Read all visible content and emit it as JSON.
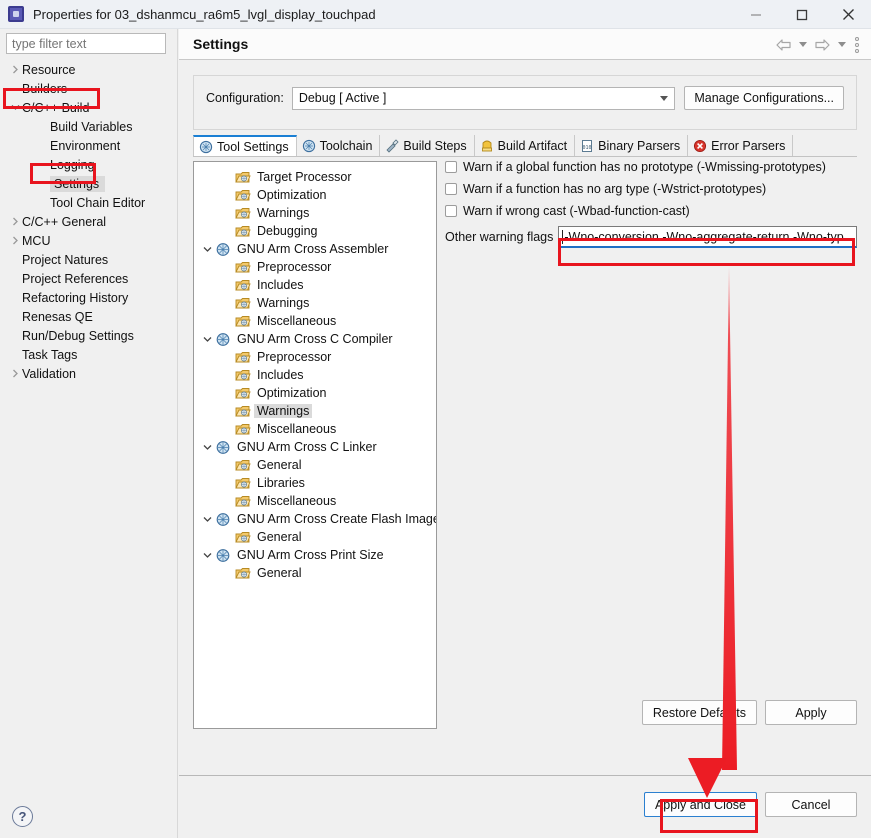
{
  "window": {
    "title": "Properties for 03_dshanmcu_ra6m5_lvgl_display_touchpad",
    "icon": "properties-app-icon",
    "minimize_label": "minimize-icon",
    "maximize_label": "maximize-icon",
    "close_label": "close-icon"
  },
  "sidebar": {
    "filter_placeholder": "type filter text",
    "filter_value": "",
    "items": [
      {
        "label": "Resource",
        "indent": 0,
        "twisty": "collapsed",
        "selected": false
      },
      {
        "label": "Builders",
        "indent": 0,
        "twisty": "none",
        "selected": false
      },
      {
        "label": "C/C++ Build",
        "indent": 0,
        "twisty": "expanded",
        "selected": false
      },
      {
        "label": "Build Variables",
        "indent": 1,
        "twisty": "none",
        "selected": false
      },
      {
        "label": "Environment",
        "indent": 1,
        "twisty": "none",
        "selected": false
      },
      {
        "label": "Logging",
        "indent": 1,
        "twisty": "none",
        "selected": false
      },
      {
        "label": "Settings",
        "indent": 1,
        "twisty": "none",
        "selected": true
      },
      {
        "label": "Tool Chain Editor",
        "indent": 1,
        "twisty": "none",
        "selected": false
      },
      {
        "label": "C/C++ General",
        "indent": 0,
        "twisty": "collapsed",
        "selected": false
      },
      {
        "label": "MCU",
        "indent": 0,
        "twisty": "collapsed",
        "selected": false
      },
      {
        "label": "Project Natures",
        "indent": 0,
        "twisty": "none",
        "selected": false
      },
      {
        "label": "Project References",
        "indent": 0,
        "twisty": "none",
        "selected": false
      },
      {
        "label": "Refactoring History",
        "indent": 0,
        "twisty": "none",
        "selected": false
      },
      {
        "label": "Renesas QE",
        "indent": 0,
        "twisty": "none",
        "selected": false
      },
      {
        "label": "Run/Debug Settings",
        "indent": 0,
        "twisty": "none",
        "selected": false
      },
      {
        "label": "Task Tags",
        "indent": 0,
        "twisty": "none",
        "selected": false
      },
      {
        "label": "Validation",
        "indent": 0,
        "twisty": "collapsed",
        "selected": false
      }
    ],
    "help_icon": "?"
  },
  "header": {
    "title": "Settings",
    "back_icon": "back-arrow-icon",
    "forward_icon": "forward-arrow-icon",
    "menu_icon": "view-menu-icon"
  },
  "configuration": {
    "label": "Configuration:",
    "value": "Debug  [ Active ]",
    "manage_button": "Manage Configurations..."
  },
  "tabs": [
    {
      "label": "Tool Settings",
      "icon": "tool-settings-icon",
      "active": true
    },
    {
      "label": "Toolchain",
      "icon": "toolchain-icon",
      "active": false
    },
    {
      "label": "Build Steps",
      "icon": "build-steps-icon",
      "active": false
    },
    {
      "label": "Build Artifact",
      "icon": "build-artifact-icon",
      "active": false
    },
    {
      "label": "Binary Parsers",
      "icon": "binary-parsers-icon",
      "active": false
    },
    {
      "label": "Error Parsers",
      "icon": "error-parsers-icon",
      "active": false
    }
  ],
  "tool_tree": [
    {
      "label": "Target Processor",
      "indent": 1,
      "twisty": "none",
      "icon": "page-icon",
      "selected": false
    },
    {
      "label": "Optimization",
      "indent": 1,
      "twisty": "none",
      "icon": "page-icon",
      "selected": false
    },
    {
      "label": "Warnings",
      "indent": 1,
      "twisty": "none",
      "icon": "page-icon",
      "selected": false
    },
    {
      "label": "Debugging",
      "indent": 1,
      "twisty": "none",
      "icon": "page-icon",
      "selected": false
    },
    {
      "label": "GNU Arm Cross Assembler",
      "indent": 0,
      "twisty": "expanded",
      "icon": "tool-icon",
      "selected": false
    },
    {
      "label": "Preprocessor",
      "indent": 1,
      "twisty": "none",
      "icon": "page-icon",
      "selected": false
    },
    {
      "label": "Includes",
      "indent": 1,
      "twisty": "none",
      "icon": "page-icon",
      "selected": false
    },
    {
      "label": "Warnings",
      "indent": 1,
      "twisty": "none",
      "icon": "page-icon",
      "selected": false
    },
    {
      "label": "Miscellaneous",
      "indent": 1,
      "twisty": "none",
      "icon": "page-icon",
      "selected": false
    },
    {
      "label": "GNU Arm Cross C Compiler",
      "indent": 0,
      "twisty": "expanded",
      "icon": "tool-icon",
      "selected": false
    },
    {
      "label": "Preprocessor",
      "indent": 1,
      "twisty": "none",
      "icon": "page-icon",
      "selected": false
    },
    {
      "label": "Includes",
      "indent": 1,
      "twisty": "none",
      "icon": "page-icon",
      "selected": false
    },
    {
      "label": "Optimization",
      "indent": 1,
      "twisty": "none",
      "icon": "page-icon",
      "selected": false
    },
    {
      "label": "Warnings",
      "indent": 1,
      "twisty": "none",
      "icon": "page-icon",
      "selected": true
    },
    {
      "label": "Miscellaneous",
      "indent": 1,
      "twisty": "none",
      "icon": "page-icon",
      "selected": false
    },
    {
      "label": "GNU Arm Cross C Linker",
      "indent": 0,
      "twisty": "expanded",
      "icon": "tool-icon",
      "selected": false
    },
    {
      "label": "General",
      "indent": 1,
      "twisty": "none",
      "icon": "page-icon",
      "selected": false
    },
    {
      "label": "Libraries",
      "indent": 1,
      "twisty": "none",
      "icon": "page-icon",
      "selected": false
    },
    {
      "label": "Miscellaneous",
      "indent": 1,
      "twisty": "none",
      "icon": "page-icon",
      "selected": false
    },
    {
      "label": "GNU Arm Cross Create Flash Image",
      "indent": 0,
      "twisty": "expanded",
      "icon": "tool-icon",
      "selected": false
    },
    {
      "label": "General",
      "indent": 1,
      "twisty": "none",
      "icon": "page-icon",
      "selected": false
    },
    {
      "label": "GNU Arm Cross Print Size",
      "indent": 0,
      "twisty": "expanded",
      "icon": "tool-icon",
      "selected": false
    },
    {
      "label": "General",
      "indent": 1,
      "twisty": "none",
      "icon": "page-icon",
      "selected": false
    }
  ],
  "warnings_pane": {
    "checkboxes": [
      {
        "label": "Warn if a global function has no prototype (-Wmissing-prototypes)",
        "checked": false
      },
      {
        "label": "Warn if a function has no arg type (-Wstrict-prototypes)",
        "checked": false
      },
      {
        "label": "Warn if wrong cast  (-Wbad-function-cast)",
        "checked": false
      }
    ],
    "other_flags_label": "Other warning flags",
    "other_flags_value": "-Wno-conversion -Wno-aggregate-return -Wno-typ"
  },
  "page_buttons": {
    "restore_defaults": "Restore Defaults",
    "apply": "Apply"
  },
  "footer_buttons": {
    "apply_and_close": "Apply and Close",
    "cancel": "Cancel"
  },
  "annotations": {
    "accent_color": "#e8141e",
    "arrow_from": "other-warning-flags-field",
    "arrow_to": "apply-and-close-button"
  }
}
